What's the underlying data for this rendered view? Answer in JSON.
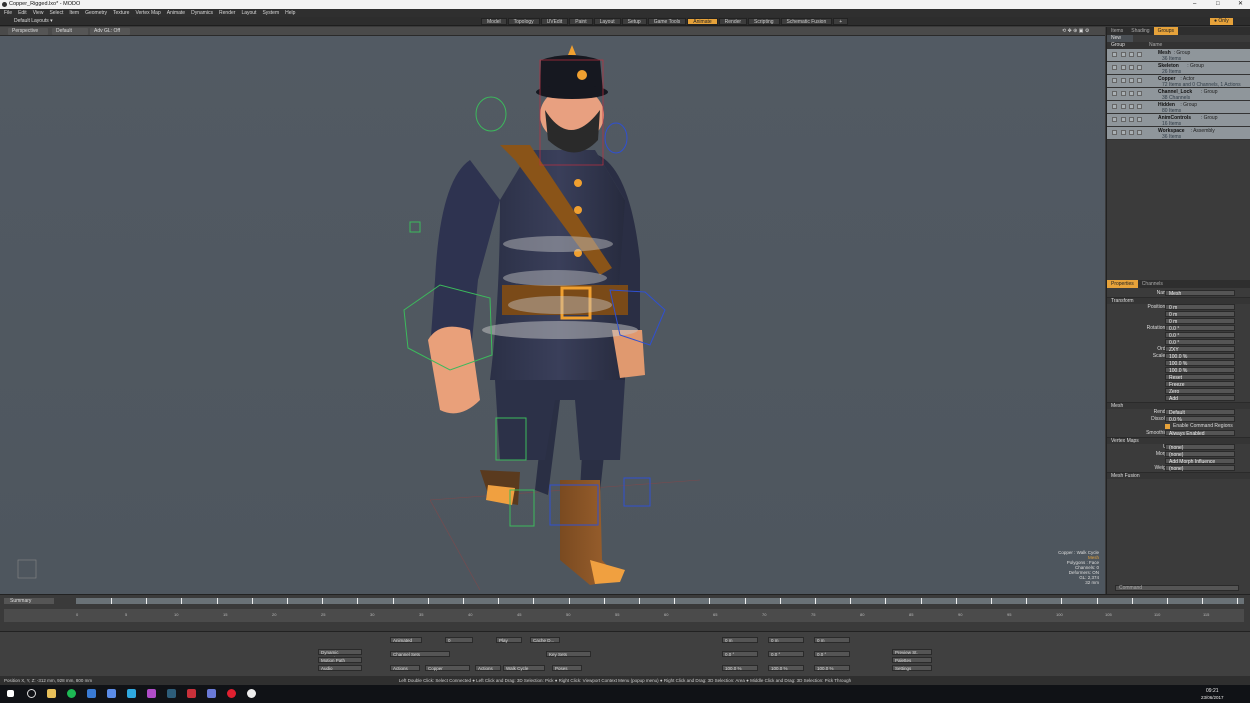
{
  "window": {
    "title": "Copper_Rigged.lxo* - MODO",
    "min": "–",
    "max": "□",
    "close": "✕"
  },
  "menu": [
    "File",
    "Edit",
    "View",
    "Select",
    "Item",
    "Geometry",
    "Texture",
    "Vertex Map",
    "Animate",
    "Dynamics",
    "Render",
    "Layout",
    "System",
    "Help"
  ],
  "layout_selector": "Default Layouts ▾",
  "tabs": [
    "Model",
    "Topology",
    "UVEdit",
    "Paint",
    "Layout",
    "Setup",
    "Game Tools",
    "Animate",
    "Render",
    "Scripting",
    "Schematic Fusion"
  ],
  "active_tab": "Animate",
  "add_tab": "+",
  "only_label": "● Only",
  "viewport": {
    "view": "Perspective",
    "shading": "Default",
    "mode": "Adv GL: Off",
    "info": [
      "Copper : Walk Cycle",
      "Mesh",
      "Polygons : Face",
      "Channels: 0",
      "Deformers: ON",
      "GL: 2,374",
      "32 mm"
    ]
  },
  "right_tabs": [
    "Items",
    "Shading",
    "Groups"
  ],
  "active_right_tab": "Groups",
  "new_group": "New Group",
  "groups_header": "Name",
  "groups": [
    {
      "name": "Mesh",
      "type": ": Group",
      "sub": "36 Items"
    },
    {
      "name": "Skeleton",
      "type": ": Group",
      "sub": "26 Items"
    },
    {
      "name": "Copper",
      "type": ": Actor",
      "sub": "72 Items and 0 Channels, 1 Actions"
    },
    {
      "name": "Channel_Lock",
      "type": ": Group",
      "sub": "38 Channels"
    },
    {
      "name": "Hidden",
      "type": ": Group",
      "sub": "80 Items"
    },
    {
      "name": "AnimControls",
      "type": ": Group",
      "sub": "16 Items"
    },
    {
      "name": "Workspace",
      "type": ": Assembly",
      "sub": "36 Items"
    }
  ],
  "prop_tabs": [
    "Properties",
    "Channels"
  ],
  "properties": {
    "name_label": "Name",
    "name_value": "Mesh",
    "transform": "Transform",
    "rows": [
      {
        "label": "Position X",
        "value": "0 m"
      },
      {
        "label": "Y",
        "value": "0 m"
      },
      {
        "label": "Z",
        "value": "0 m"
      },
      {
        "label": "Rotation X",
        "value": "0.0 °"
      },
      {
        "label": "Y",
        "value": "0.0 °"
      },
      {
        "label": "Z",
        "value": "0.0 °"
      },
      {
        "label": "Order",
        "value": "ZXY"
      },
      {
        "label": "Scale X",
        "value": "100.0 %"
      },
      {
        "label": "Y",
        "value": "100.0 %"
      },
      {
        "label": "Z",
        "value": "100.0 %"
      }
    ],
    "buttons": [
      "Reset",
      "Freeze",
      "Zero",
      "Add"
    ],
    "mesh": "Mesh",
    "render_label": "Render",
    "render_value": "Default",
    "dissolve_label": "Dissolve",
    "dissolve_value": "0.0 %",
    "command_regions": "Enable Command Regions",
    "smoothing_label": "Smoothing",
    "smoothing_value": "Always Enabled",
    "vertex_maps": "Vertex Maps",
    "uv_label": "UV",
    "uv_value": "(none)",
    "morph_label": "Morph",
    "morph_value": "(none)",
    "morph_influence": "Add Morph Influence",
    "weight_label": "Weight",
    "weight_value": "(none)",
    "mesh_fusion": "Mesh Fusion",
    "command": "Command"
  },
  "timeline": {
    "channel": "Summary",
    "ticks": [
      "0",
      "5",
      "10",
      "15",
      "20",
      "25",
      "30",
      "35",
      "40",
      "45",
      "50",
      "55",
      "60",
      "65",
      "70",
      "75",
      "80",
      "85",
      "90",
      "95",
      "100",
      "105",
      "110",
      "115",
      "120"
    ]
  },
  "controls": {
    "animated": "Animated",
    "frame": "0",
    "play": "Play",
    "cache": "Cache D...",
    "channel_sets": "Channel Sets",
    "key_sets": "Key Sets",
    "actions_label": "Actions",
    "actor": "Copper",
    "actions2": "Actions",
    "action": "Walk Cycle",
    "poses": "Poses",
    "dynamic_parenting": "Dynamic Parenting",
    "motion_path": "Motion Path",
    "audio": "Audio",
    "pos": [
      "0 m",
      "0 m",
      "0 m"
    ],
    "rot": [
      "0.0 °",
      "0.0 °",
      "0.0 °"
    ],
    "scl": [
      "100.0 %",
      "100.0 %",
      "100.0 %"
    ],
    "preview": "Preview St.",
    "palettes": "Palettes",
    "settings": "Settings"
  },
  "status_left": "Position X, Y, Z:  -312 mm, 928 mm, 800 mm",
  "status": "Left Double Click: Select Connected ● Left Click and Drag: 3D Selection: Pick ● Right Click: Viewport Context Menu (popup menu) ● Right Click and Drag: 3D Selection: Area ● Middle Click and Drag: 3D Selection: Pick Through",
  "clock": {
    "time": "09:21",
    "date": "23/06/2017"
  },
  "colors": {
    "accent": "#e6a23a",
    "viewport": "#50585f",
    "panel": "#3b3b3b"
  }
}
